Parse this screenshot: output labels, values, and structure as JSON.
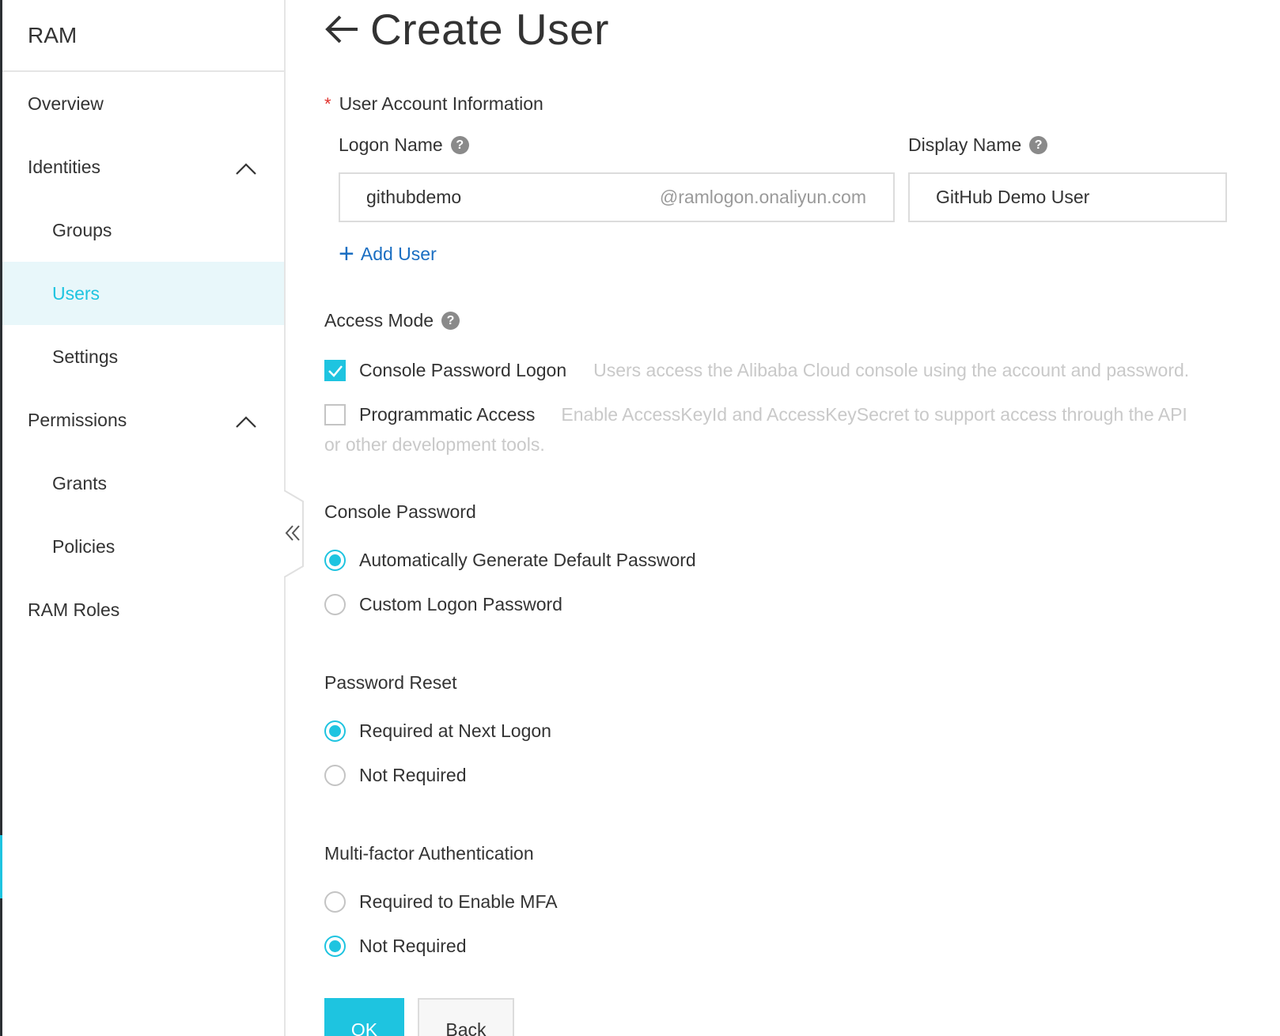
{
  "sidebar": {
    "title": "RAM",
    "items": [
      {
        "label": "Overview"
      },
      {
        "label": "Identities"
      },
      {
        "label": "Groups"
      },
      {
        "label": "Users"
      },
      {
        "label": "Settings"
      },
      {
        "label": "Permissions"
      },
      {
        "label": "Grants"
      },
      {
        "label": "Policies"
      },
      {
        "label": "RAM Roles"
      }
    ],
    "active_item": "Users"
  },
  "page": {
    "title": "Create User"
  },
  "account_info": {
    "section_label": "User Account Information",
    "logon_name_label": "Logon Name",
    "logon_name_value": "githubdemo",
    "logon_suffix": "@ramlogon.onaliyun.com",
    "display_name_label": "Display Name",
    "display_name_value": "GitHub Demo User",
    "add_user_label": "Add User"
  },
  "access_mode": {
    "label": "Access Mode",
    "console_label": "Console Password Logon",
    "console_hint": "Users access the Alibaba Cloud console using the account and password.",
    "console_checked": true,
    "programmatic_label": "Programmatic Access",
    "programmatic_hint_1": "Enable AccessKeyId and AccessKeySecret to support access through the API",
    "programmatic_hint_2": "or other development tools.",
    "programmatic_checked": false
  },
  "console_password": {
    "label": "Console Password",
    "options": [
      "Automatically Generate Default Password",
      "Custom Logon Password"
    ],
    "selected": 0
  },
  "password_reset": {
    "label": "Password Reset",
    "options": [
      "Required at Next Logon",
      "Not Required"
    ],
    "selected": 0
  },
  "mfa": {
    "label": "Multi-factor Authentication",
    "options": [
      "Required to Enable MFA",
      "Not Required"
    ],
    "selected": 1
  },
  "buttons": {
    "ok": "OK",
    "back": "Back"
  },
  "colors": {
    "accent": "#1ec4e0",
    "link": "#1a6ec2",
    "required": "#e0302b"
  }
}
